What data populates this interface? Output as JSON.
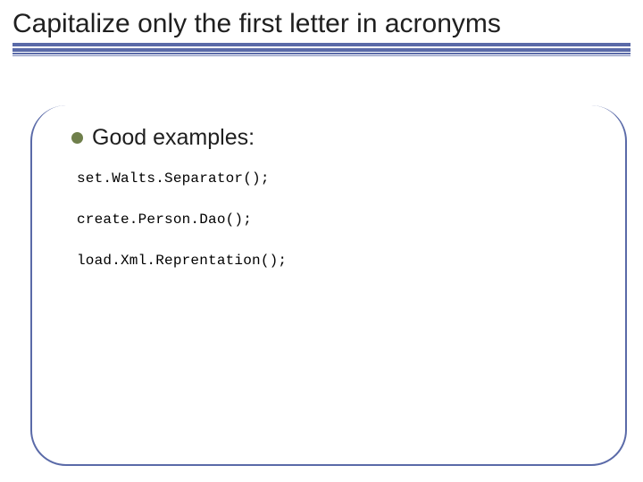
{
  "title": "Capitalize only the first letter in acronyms",
  "bullet": {
    "label": "Good examples:"
  },
  "code": {
    "line1": "set.Walts.Separator();",
    "line2": "create.Person.Dao();",
    "line3": "load.Xml.Reprentation();"
  }
}
